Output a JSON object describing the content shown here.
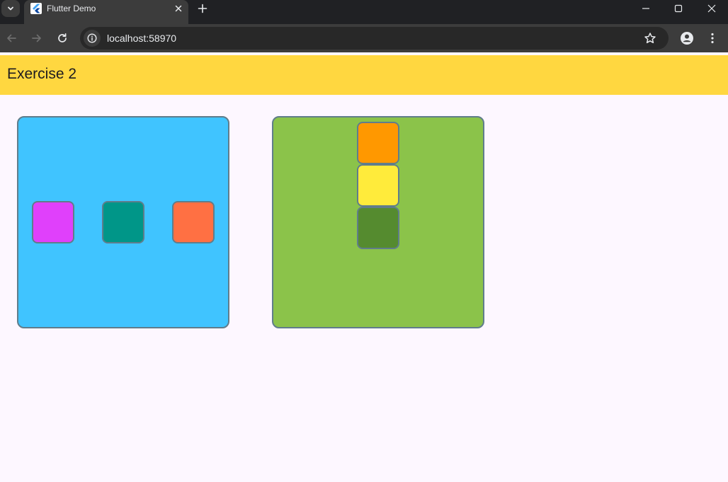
{
  "browser": {
    "tab": {
      "title": "Flutter Demo"
    },
    "address_bar": {
      "url": "localhost:58970"
    }
  },
  "app": {
    "title": "Exercise 2",
    "colors": {
      "appbar": "#ffd740",
      "background": "#fdf7ff",
      "border": "#607d8b"
    },
    "row_container": {
      "color": "#40c4ff",
      "boxes": [
        {
          "color": "#e040fb"
        },
        {
          "color": "#009688"
        },
        {
          "color": "#ff7043"
        }
      ]
    },
    "column_container": {
      "color": "#8bc34a",
      "boxes": [
        {
          "color": "#ff9800"
        },
        {
          "color": "#ffeb3b"
        },
        {
          "color": "#558b2f"
        }
      ]
    }
  },
  "icons": {
    "tab_search": "chevron-down-icon",
    "tab_favicon": "flutter-logo-icon",
    "tab_close": "close-icon",
    "new_tab": "plus-icon",
    "back": "arrow-left-icon",
    "forward": "arrow-right-icon",
    "reload": "reload-icon",
    "site_info": "info-icon",
    "bookmark": "star-icon",
    "profile": "person-icon",
    "menu": "kebab-menu-icon"
  }
}
